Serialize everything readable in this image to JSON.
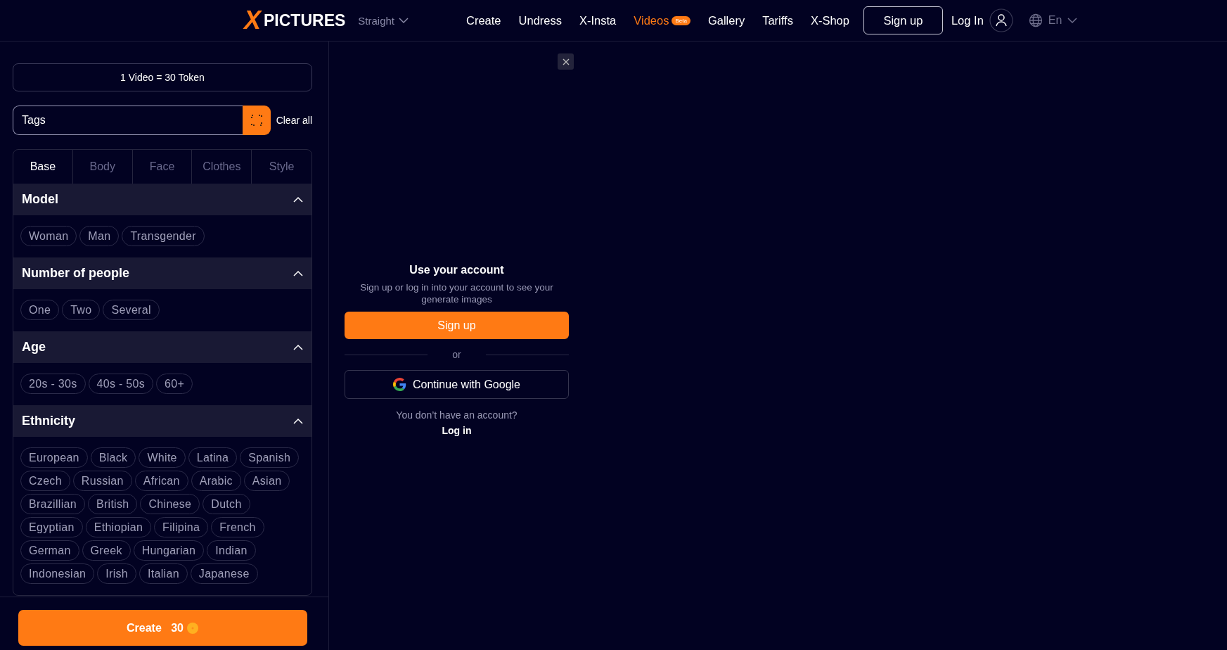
{
  "header": {
    "logo_mark": "X",
    "logo_text": "PICTURES",
    "mode": "Straight",
    "nav": [
      {
        "label": "Create",
        "selected": false
      },
      {
        "label": "Undress",
        "selected": false
      },
      {
        "label": "X-Insta",
        "selected": false
      },
      {
        "label": "Videos",
        "selected": true,
        "badge": "Beta"
      },
      {
        "label": "Gallery",
        "selected": false
      },
      {
        "label": "Tariffs",
        "selected": false
      },
      {
        "label": "X-Shop",
        "selected": false
      }
    ],
    "signup": "Sign up",
    "login": "Log In",
    "language": "En"
  },
  "sidebar": {
    "price": "1 Video = 30 Token",
    "tags": {
      "placeholder": "Tags"
    },
    "clear": "Clear all",
    "tabs": [
      {
        "label": "Base",
        "selected": true
      },
      {
        "label": "Body",
        "selected": false
      },
      {
        "label": "Face",
        "selected": false
      },
      {
        "label": "Clothes",
        "selected": false
      },
      {
        "label": "Style",
        "selected": false
      }
    ],
    "sections": [
      {
        "title": "Model",
        "expanded": true,
        "chips": [
          {
            "label": "Woman",
            "selected": false
          },
          {
            "label": "Man",
            "selected": false
          },
          {
            "label": "Transgender",
            "selected": false
          }
        ]
      },
      {
        "title": "Number of people",
        "expanded": true,
        "chips": [
          {
            "label": "One",
            "selected": false
          },
          {
            "label": "Two",
            "selected": false
          },
          {
            "label": "Several",
            "selected": false
          }
        ]
      },
      {
        "title": "Age",
        "expanded": true,
        "chips": [
          {
            "label": "20s - 30s",
            "selected": false
          },
          {
            "label": "40s - 50s",
            "selected": false
          },
          {
            "label": "60+",
            "selected": false
          }
        ]
      },
      {
        "title": "Ethnicity",
        "expanded": true,
        "chips": [
          {
            "label": "European",
            "selected": false
          },
          {
            "label": "Black",
            "selected": false
          },
          {
            "label": "White",
            "selected": false
          },
          {
            "label": "Latina",
            "selected": false
          },
          {
            "label": "Spanish",
            "selected": false
          },
          {
            "label": "Czech",
            "selected": false
          },
          {
            "label": "Russian",
            "selected": false
          },
          {
            "label": "African",
            "selected": false
          },
          {
            "label": "Arabic",
            "selected": false
          },
          {
            "label": "Asian",
            "selected": false
          },
          {
            "label": "Brazillian",
            "selected": false
          },
          {
            "label": "British",
            "selected": false
          },
          {
            "label": "Chinese",
            "selected": false
          },
          {
            "label": "Dutch",
            "selected": false
          },
          {
            "label": "Egyptian",
            "selected": false
          },
          {
            "label": "Ethiopian",
            "selected": false
          },
          {
            "label": "Filipina",
            "selected": false
          },
          {
            "label": "French",
            "selected": false
          },
          {
            "label": "German",
            "selected": false
          },
          {
            "label": "Greek",
            "selected": false
          },
          {
            "label": "Hungarian",
            "selected": false
          },
          {
            "label": "Indian",
            "selected": false
          },
          {
            "label": "Indonesian",
            "selected": false
          },
          {
            "label": "Irish",
            "selected": false
          },
          {
            "label": "Italian",
            "selected": false
          },
          {
            "label": "Japanese",
            "selected": false
          }
        ]
      }
    ],
    "create": {
      "label": "Create",
      "cost": "30"
    }
  },
  "account": {
    "title": "Use your account",
    "text": "Sign up or log in into your account to see your generate images",
    "signup": "Sign up",
    "or": "or",
    "google": "Continue with Google",
    "question": "You don’t have an account?",
    "login": "Log in"
  }
}
